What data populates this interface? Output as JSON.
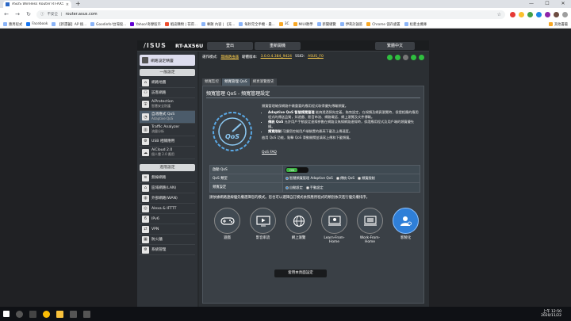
{
  "browser": {
    "tab_title": "ASUS Wireless Router RT-AX56U",
    "new_tab": "+",
    "tab_close": "×",
    "secure_label": "不安全",
    "url": "router.asus.com",
    "bookmarks": [
      "應用程式",
      "Facebook",
      "【新還蕃】AP 搜...",
      "Goodinfo!台灣股...",
      "Yahoo!奇摩股市",
      "蝦皮購物 | 花得...",
      "專題 內容 | 【充...",
      "每秒完全手機 - 最...",
      "3C",
      "MIUI教學",
      "新聞總覽",
      "伊莉討論區",
      "Chrome 儲存處置",
      "松菱主機庫",
      "其他書籤"
    ],
    "window_controls": [
      "—",
      "☐",
      "✕"
    ]
  },
  "router": {
    "logo": "/ISUS",
    "model": "RT-AX56U",
    "logout": "登出",
    "reboot": "重新開機",
    "language": "繁體中文",
    "status": {
      "mode_label": "運作模式:",
      "mode_value": "無線路由器",
      "fw_label": "韌體版本:",
      "fw_value": "3.0.0.4.384_9424",
      "ssid_label": "SSID:",
      "ssid_value": "ASUS_F0"
    },
    "sidebar": {
      "quick_setup": "網路設定精靈",
      "general_header": "一般設定",
      "general": [
        {
          "label": "網路地圖",
          "sub": ""
        },
        {
          "label": "訪客網路",
          "sub": ""
        },
        {
          "label": "AiProtection",
          "sub": "智慧安全防護"
        },
        {
          "label": "自適應式 QoS",
          "sub": "Adaptive QoS"
        },
        {
          "label": "Traffic Analyzer",
          "sub": "流量分析"
        },
        {
          "label": "USB 相關應用",
          "sub": ""
        },
        {
          "label": "AiCloud 2.0",
          "sub": "個人雲 2.0 應用"
        }
      ],
      "advanced_header": "進階設定",
      "advanced": [
        "無線網路",
        "區域網路(LAN)",
        "外部網路(WAN)",
        "Alexa & IFTTT",
        "IPv6",
        "VPN",
        "防火牆",
        "系統管理"
      ]
    },
    "tabs": [
      "頻寬監控",
      "頻寬管理 QoS",
      "網頁瀏覽歷史"
    ],
    "panel": {
      "title": "頻寬管理 QoS - 頻寬管理設定",
      "intro": "頻寬管理確保網路中最重要的應用程式取得優先傳輸頻寬。",
      "bullets": [
        {
          "head": "Adaptive QoS 智慧頻寬管理",
          "text": "能夠透過預先定義，拖曳設定，在視頻及網頁瀏覽時，保證相應的應用程式的傳送品質，如遊戲、影音串流、網路電話、網上瀏覽及文件傳輸。"
        },
        {
          "head": "傳統 QoS",
          "text": "允許用戶手動設定連線參數在網路及無線網路連線時，保證應用程式及用戶端的頻寬優先權。"
        },
        {
          "head": "頻寬限制",
          "text": "可讓您控制用戶端裝置的最高下載及上傳速度。"
        }
      ],
      "enable_note": "啟用 QoS 功能，點擊 QoS 滑動開關並填寫上傳和下載頻寬。",
      "faq": "QoS FAQ",
      "rows": {
        "enable_label": "啟動 QoS",
        "toggle_on": "ON",
        "type_label": "QoS 類型",
        "type_options": [
          "智慧頻寬管理 Adaptive QoS",
          "傳統 QoS",
          "頻寬限制"
        ],
        "bw_label": "頻寬設定",
        "bw_options": [
          "自動設定",
          "手動設定"
        ]
      },
      "hint": "請依據網路連線優先權選擇您的模式。您也可以選擇自訂模式依照應用程式的類別依次進行優先權排序。",
      "modes": [
        "遊戲",
        "影音串流",
        "網上瀏覽",
        "Learn-From-Home",
        "Work-From-Home",
        "客製化"
      ],
      "apply": "套用本頁面設定"
    }
  },
  "taskbar": {
    "time": "上午 12:50",
    "date": "2020/11/22"
  }
}
